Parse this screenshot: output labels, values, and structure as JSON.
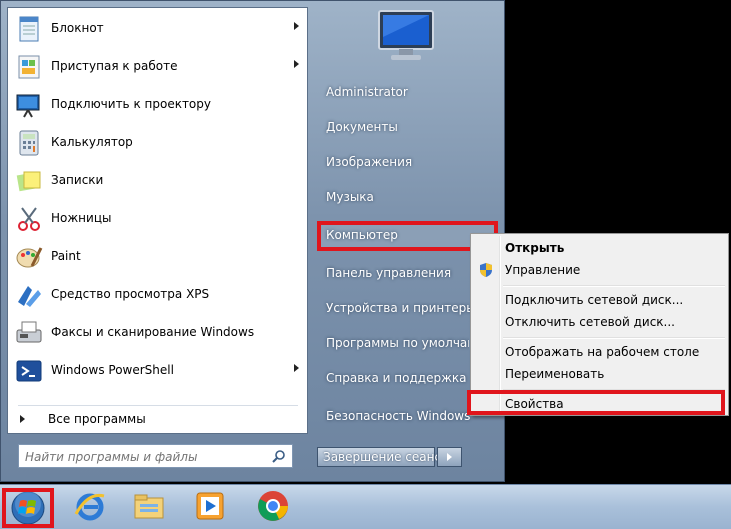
{
  "programs": [
    {
      "label": "Блокнот",
      "icon": "notepad-icon",
      "submenu": true
    },
    {
      "label": "Приступая к работе",
      "icon": "getting-started-icon",
      "submenu": true
    },
    {
      "label": "Подключить к проектору",
      "icon": "projector-icon",
      "submenu": false
    },
    {
      "label": "Калькулятор",
      "icon": "calculator-icon",
      "submenu": false
    },
    {
      "label": "Записки",
      "icon": "sticky-notes-icon",
      "submenu": false
    },
    {
      "label": "Ножницы",
      "icon": "snipping-tool-icon",
      "submenu": false
    },
    {
      "label": "Paint",
      "icon": "paint-icon",
      "submenu": false
    },
    {
      "label": "Средство просмотра XPS",
      "icon": "xps-viewer-icon",
      "submenu": false
    },
    {
      "label": "Факсы и сканирование Windows",
      "icon": "fax-scan-icon",
      "submenu": false
    },
    {
      "label": "Windows PowerShell",
      "icon": "powershell-icon",
      "submenu": true
    }
  ],
  "all_programs": "Все программы",
  "search": {
    "placeholder": "Найти программы и файлы",
    "value": ""
  },
  "right_links": [
    "Administrator",
    "Документы",
    "Изображения",
    "Музыка",
    "Компьютер",
    "Панель управления",
    "Устройства и принтеры",
    "Программы по умолчанию",
    "Справка и поддержка",
    "Безопасность Windows"
  ],
  "shutdown_label": "Завершение сеанса",
  "context_menu": [
    {
      "label": "Открыть",
      "bold": true
    },
    {
      "label": "Управление",
      "icon": "uac-shield-icon"
    },
    {
      "label": "Подключить сетевой диск..."
    },
    {
      "label": "Отключить сетевой диск..."
    },
    {
      "label": "Отображать на рабочем столе"
    },
    {
      "label": "Переименовать"
    },
    {
      "label": "Свойства"
    }
  ],
  "taskbar": [
    {
      "icon": "start-orb-icon"
    },
    {
      "icon": "internet-explorer-icon"
    },
    {
      "icon": "windows-explorer-icon"
    },
    {
      "icon": "media-player-icon"
    },
    {
      "icon": "chrome-icon"
    }
  ],
  "colors": {
    "highlight": "#e0151c",
    "menu_bg": "#7d93ad"
  }
}
